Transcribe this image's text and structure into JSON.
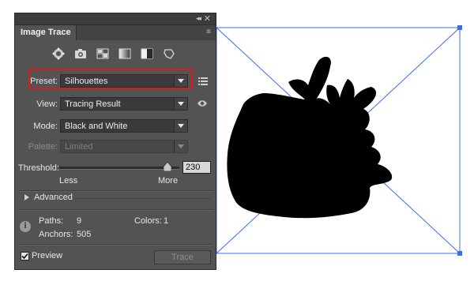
{
  "panel": {
    "title": "Image Trace",
    "collapse_glyph": "◂◂",
    "close_glyph": "✕",
    "menu_glyph": "≡"
  },
  "preset_icons": [
    "auto-color-icon",
    "high-color-icon",
    "low-color-icon",
    "grayscale-icon",
    "black-white-icon",
    "outline-icon"
  ],
  "preset": {
    "label": "Preset:",
    "value": "Silhouettes"
  },
  "view": {
    "label": "View:",
    "value": "Tracing Result"
  },
  "mode": {
    "label": "Mode:",
    "value": "Black and White"
  },
  "palette": {
    "label": "Palette:",
    "value": "Limited"
  },
  "threshold": {
    "label": "Threshold:",
    "value": "230",
    "less": "Less",
    "more": "More",
    "level": 0.9
  },
  "advanced": {
    "label": "Advanced"
  },
  "stats": {
    "paths_label": "Paths:",
    "paths": "9",
    "colors_label": "Colors:",
    "colors": "1",
    "anchors_label": "Anchors:",
    "anchors": "505"
  },
  "preview": {
    "label": "Preview",
    "checked": true
  },
  "trace_button": "Trace",
  "colors": {
    "panel_bg": "#535353",
    "highlight": "#e01b1b",
    "selection": "#3a6cf0"
  }
}
